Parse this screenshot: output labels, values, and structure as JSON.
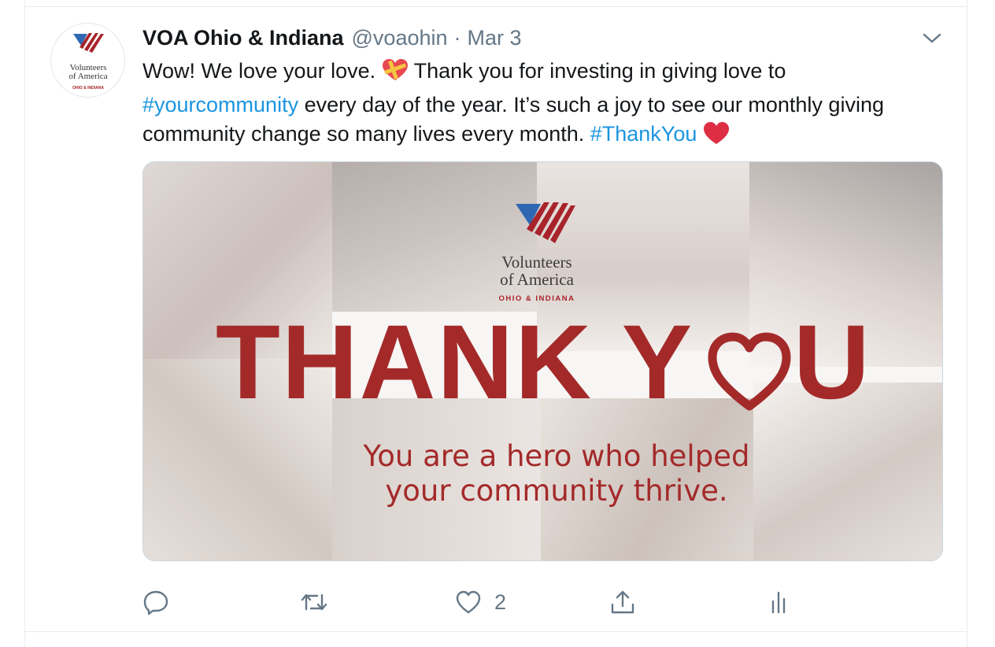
{
  "tweet": {
    "author_name": "VOA Ohio & Indiana",
    "handle": "@voaohin",
    "separator": "·",
    "date": "Mar 3",
    "text": {
      "part1": "Wow! We love your love. ",
      "part2": " Thank you for investing in giving love to ",
      "hashtag1": "#yourcommunity",
      "part3": " every day of the year. It’s such a joy to see our monthly giving community change so many lives every month. ",
      "hashtag2": "#ThankYou",
      "part4": " "
    },
    "avatar": {
      "org_line1": "Volunteers",
      "org_line2": "of America",
      "region": "OHIO & INDIANA"
    },
    "image": {
      "org_line1": "Volunteers",
      "org_line2": "of America",
      "region": "OHIO & INDIANA",
      "headline_left": "THANK Y",
      "headline_right": "U",
      "subline1": "You are a hero who helped",
      "subline2": "your community thrive."
    },
    "actions": {
      "reply_count": "",
      "retweet_count": "",
      "like_count": "2",
      "share_label": ""
    }
  },
  "colors": {
    "link": "#1b95e0",
    "secondary_text": "#657786",
    "brand_red": "#a42a2a",
    "brand_blue": "#2f67b2"
  },
  "icons": {
    "caret": "chevron-down-icon",
    "reply": "reply-icon",
    "retweet": "retweet-icon",
    "like": "heart-icon",
    "share": "share-icon",
    "analytics": "analytics-icon"
  }
}
